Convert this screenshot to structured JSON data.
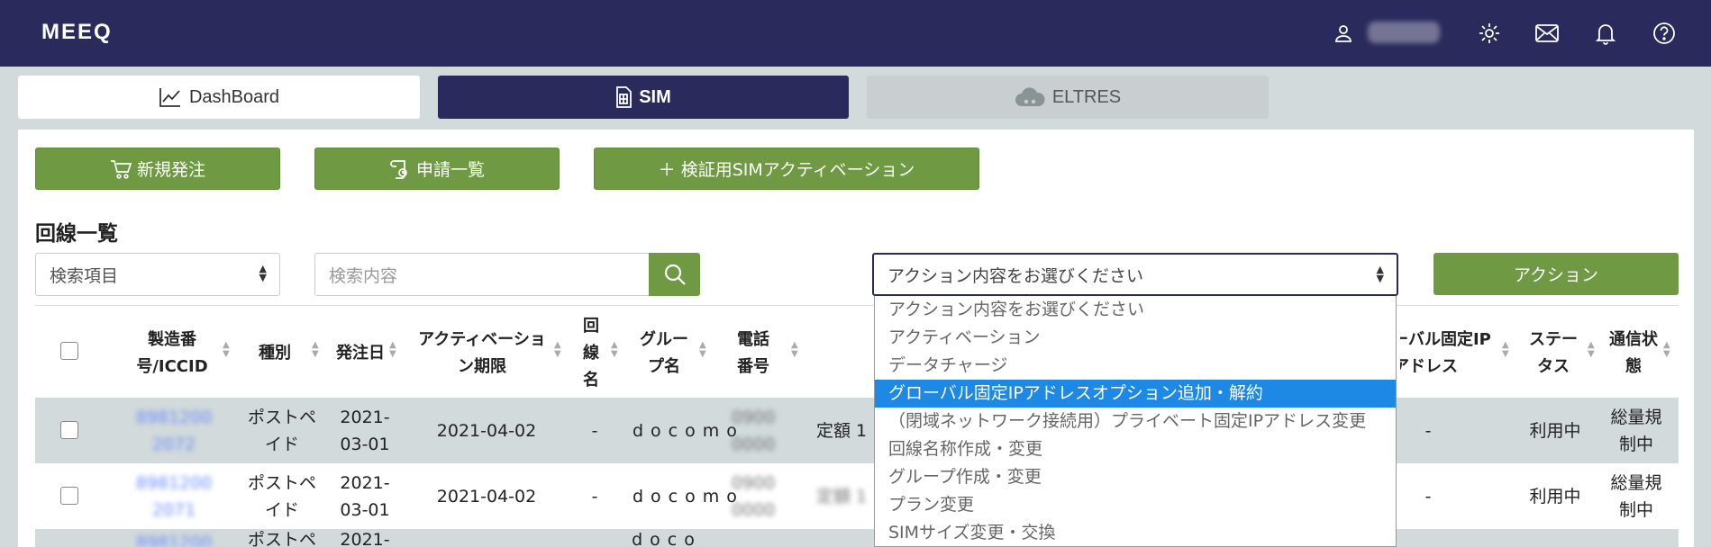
{
  "header": {
    "logo": "MEEQ",
    "icons": [
      "user-icon",
      "gear-icon",
      "mail-icon",
      "bell-icon",
      "help-icon"
    ]
  },
  "tabs": [
    {
      "label": "DashBoard",
      "icon": "chart-line-icon"
    },
    {
      "label": "SIM",
      "icon": "sim-card-icon"
    },
    {
      "label": "ELTRES",
      "icon": "cloud-icon"
    }
  ],
  "toolbar": {
    "new_order": "新規発注",
    "applications": "申請一覧",
    "verify_activation": "＋ 検証用SIMアクティベーション"
  },
  "section_title": "回線一覧",
  "search": {
    "field_select": "検索項目",
    "input_placeholder": "検索内容"
  },
  "action": {
    "select_value": "アクション内容をお選びください",
    "button": "アクション",
    "options": [
      "アクション内容をお選びください",
      "アクティベーション",
      "データチャージ",
      "グローバル固定IPアドレスオプション追加・解約",
      "（閉域ネットワーク接続用）プライベート固定IPアドレス変更",
      "回線名称作成・変更",
      "グループ作成・変更",
      "プラン変更",
      "SIMサイズ変更・交換"
    ],
    "selected_index": 3
  },
  "table": {
    "columns": [
      "製造番号/ICCID",
      "種別",
      "発注日",
      "アクティベーション期限",
      "回線名",
      "グループ名",
      "電話番号",
      "グローバル固定IPアドレス",
      "ステータス",
      "通信状態"
    ],
    "rows": [
      {
        "iccid": "8981200 2072",
        "type": "ポストペイド",
        "order_date": "2021-03-01",
        "deadline": "2021-04-02",
        "line_name": "-",
        "group": "docomo",
        "phone": "0900 0000",
        "plan": "定額 1",
        "global_ip": "-",
        "status": "利用中",
        "comm": "総量規制中"
      },
      {
        "iccid": "8981200 2071",
        "type": "ポストペイド",
        "order_date": "2021-03-01",
        "deadline": "2021-04-02",
        "line_name": "-",
        "group": "docomo",
        "phone": "0900 0000",
        "plan": "定額 1",
        "global_ip": "-",
        "status": "利用中",
        "comm": "総量規制中"
      },
      {
        "iccid": "8981200",
        "type": "ポストペ",
        "order_date": "2021-",
        "group": "doco"
      }
    ]
  },
  "colors": {
    "header_bg": "#2b2a5c",
    "green": "#6f9a43",
    "row_alt": "#d2dadb",
    "selected_option": "#1e88e5"
  }
}
